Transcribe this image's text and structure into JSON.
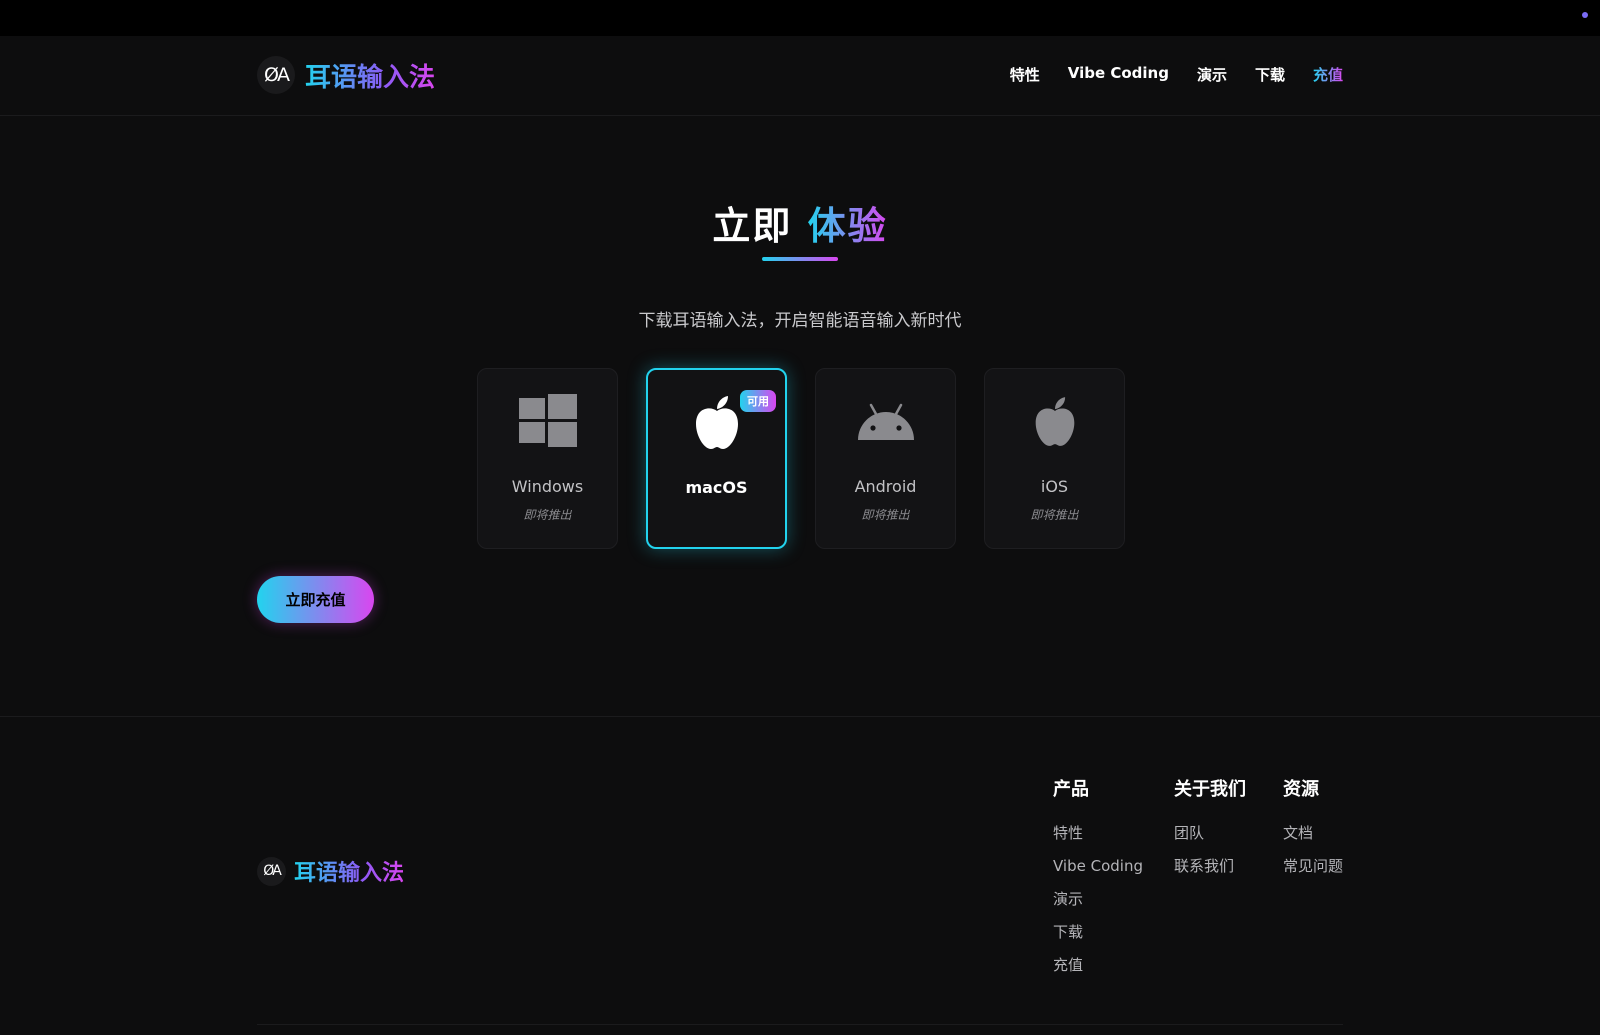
{
  "header": {
    "logo_mark": "ØA",
    "brand": "耳语输入法",
    "nav": [
      "特性",
      "Vibe Coding",
      "演示",
      "下载",
      "充值"
    ],
    "active_nav": "充值"
  },
  "hero": {
    "title_plain": "立即",
    "title_highlight": "体验",
    "subtitle": "下载耳语输入法，开启智能语音输入新时代"
  },
  "platforms": [
    {
      "name": "Windows",
      "status": "即将推出",
      "icon": "windows-icon"
    },
    {
      "name": "macOS",
      "badge": "可用",
      "icon": "apple-icon",
      "active": true
    },
    {
      "name": "Android",
      "status": "即将推出",
      "icon": "android-icon"
    },
    {
      "name": "iOS",
      "status": "即将推出",
      "icon": "apple-icon"
    }
  ],
  "cta": {
    "label": "立即充值"
  },
  "footer": {
    "logo_mark": "ØA",
    "brand": "耳语输入法",
    "columns": [
      {
        "title": "产品",
        "links": [
          "特性",
          "Vibe Coding",
          "演示",
          "下载",
          "充值"
        ]
      },
      {
        "title": "关于我们",
        "links": [
          "团队",
          "联系我们"
        ]
      },
      {
        "title": "资源",
        "links": [
          "文档",
          "常见问题"
        ]
      }
    ]
  },
  "colors": {
    "background": "#0d0d0e",
    "accent_start": "#22d3ee",
    "accent_end": "#d946ef"
  }
}
